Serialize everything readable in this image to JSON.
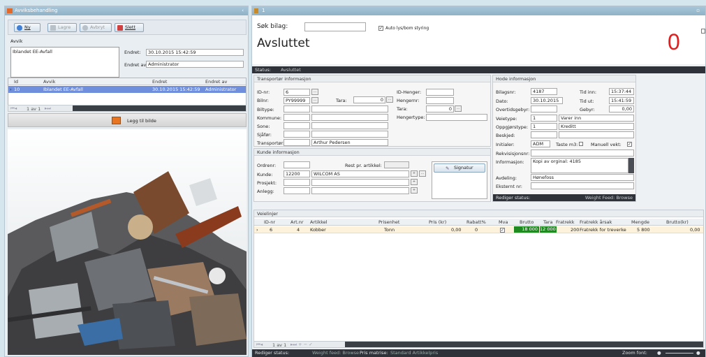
{
  "left": {
    "title": "Avviksbehandling",
    "toolbar": {
      "new": "Ny",
      "save": "Lagre",
      "undo": "Avbryt",
      "delete": "Slett"
    },
    "avvik_label": "Avvik",
    "avvik_text": "Iblandet EE-Avfall",
    "endret_label": "Endret:",
    "endret_value": "30.10.2015 15:42:59",
    "endret_av_label": "Endret av:",
    "endret_av_value": "Administrator",
    "grid": {
      "headers": [
        "Id",
        "Avvik",
        "Endret",
        "Endret av"
      ],
      "row": [
        "10",
        "Iblandet EE-Avfall",
        "30.10.2015 15:42:59",
        "Administrator"
      ]
    },
    "pager": "1 av 1",
    "add_image": "Legg til bilde"
  },
  "right": {
    "title": "1",
    "search_label": "Søk bilag:",
    "search_value": "",
    "auto_label": "Auto lys/bom styring",
    "status_big": "Avsluttet",
    "big_number": "0",
    "status_label": "Status:",
    "status_value": "Avsluttet",
    "transport": {
      "title": "Transportør informasjon",
      "idnr_label": "ID-nr:",
      "idnr": "6",
      "bilnr_label": "Bilnr:",
      "bilnr": "PY99999",
      "tara_label": "Tara:",
      "tara": "0",
      "biltype_label": "Biltype:",
      "kommune_label": "Kommune:",
      "sone_label": "Sone:",
      "sjafor_label": "Sjåfør:",
      "transportor_label": "Transportør:",
      "transportor": "Arthur Pedersen",
      "idhenger_label": "ID-Henger:",
      "hengernr_label": "Hengernr:",
      "tara2_label": "Tara:",
      "tara2": "0",
      "hengertype_label": "Hengertype:"
    },
    "kunde": {
      "title": "Kunde informasjon",
      "ordrenr_label": "Ordrenr:",
      "rest_label": "Rest pr. artikkel:",
      "kunde_label": "Kunde:",
      "kunde_id": "12200",
      "kunde_name": "WILCOM AS",
      "prosjekt_label": "Prosjekt:",
      "anlegg_label": "Anlegg:",
      "signatur": "Signatur"
    },
    "hode": {
      "title": "Hode informasjon",
      "bilagsnr_label": "Bilagsnr:",
      "bilagsnr": "4187",
      "dato_label": "Dato:",
      "dato": "30.10.2015",
      "overtid_label": "Overtidsgebyr:",
      "veietype_label": "Veietype:",
      "veietype_id": "1",
      "veietype": "Varer inn",
      "oppgjor_label": "Oppgjørstype:",
      "oppgjor_id": "1",
      "oppgjor": "Kreditt",
      "beskjed_label": "Beskjed:",
      "initialer_label": "Initialer:",
      "initialer": "ADM",
      "taste_label": "Taste m3:",
      "manuell_label": "Manuell vekt:",
      "rekv_label": "Rekvisisjonsnr:",
      "info_label": "Informasjon:",
      "info": "Kopi av orginal: 4185",
      "avdeling_label": "Avdeling:",
      "avdeling": "Hønefoss",
      "eksternt_label": "Eksternt nr:",
      "tidinn_label": "Tid inn:",
      "tidinn": "15:37:44",
      "tidut_label": "Tid ut:",
      "tidut": "15:41:59",
      "gebyr_label": "Gebyr:",
      "gebyr": "0,00",
      "rediger_label": "Rediger status:",
      "weight_label": "Weight Feed: Browse"
    },
    "veielinjer": {
      "title": "Veielinjer",
      "headers": [
        "ID-nr",
        "Art.nr",
        "Artikkel",
        "Prisenhet",
        "Pris (kr)",
        "Rabatt%",
        "Mva",
        "Brutto",
        "Tara",
        "Fratrekk",
        "Fratrekk årsak",
        "Mengde",
        "Brutto(kr)"
      ],
      "row": [
        "6",
        "4",
        "Kobber",
        "Tonn",
        "0,00",
        "0",
        "",
        "18 000",
        "12 000",
        "200",
        "Fratrekk for treverke",
        "5 800",
        "0,00"
      ]
    },
    "pager": "1 av 1",
    "bottom": {
      "rediger_label": "Rediger status:",
      "weight": "Weight feed: Browse",
      "prismatrise_label": "Pris matrise:",
      "prismatrise": "Standard Artikkelpris",
      "zoom_label": "Zoom font:"
    }
  },
  "colors": {
    "accent": "#e02020",
    "green": "#1f8a1f",
    "select": "#3f6fd0"
  }
}
